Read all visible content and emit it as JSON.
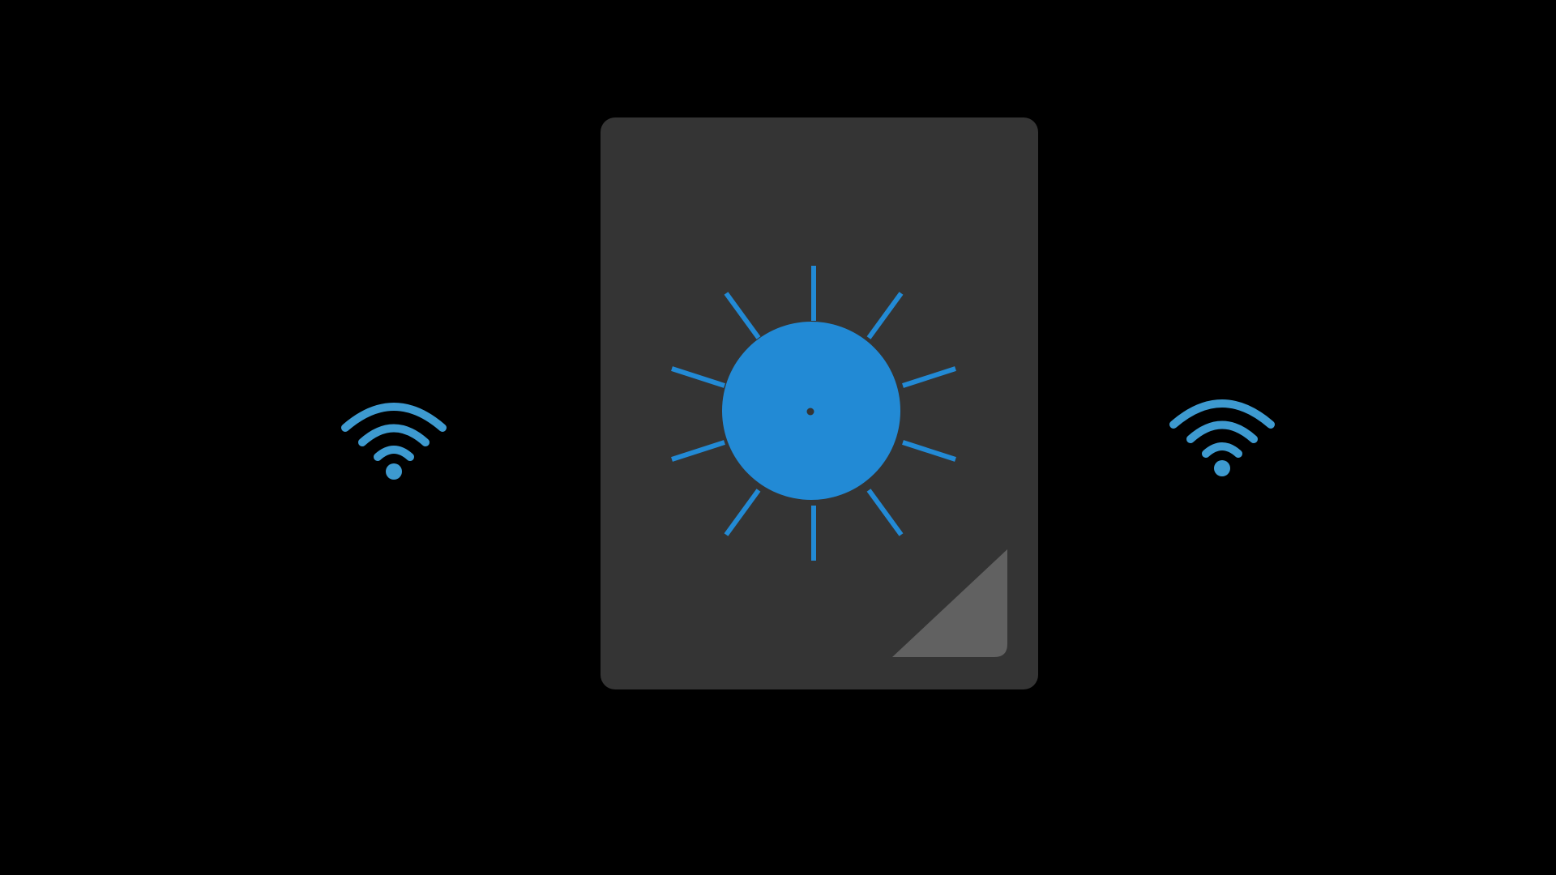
{
  "colors": {
    "background": "#000000",
    "panel": "#343434",
    "fold": "#616161",
    "accent": "#228ad5",
    "wifi": "#3d9ad0"
  },
  "icons": {
    "left": "wifi-icon",
    "center": "sun-icon",
    "right": "wifi-icon"
  }
}
